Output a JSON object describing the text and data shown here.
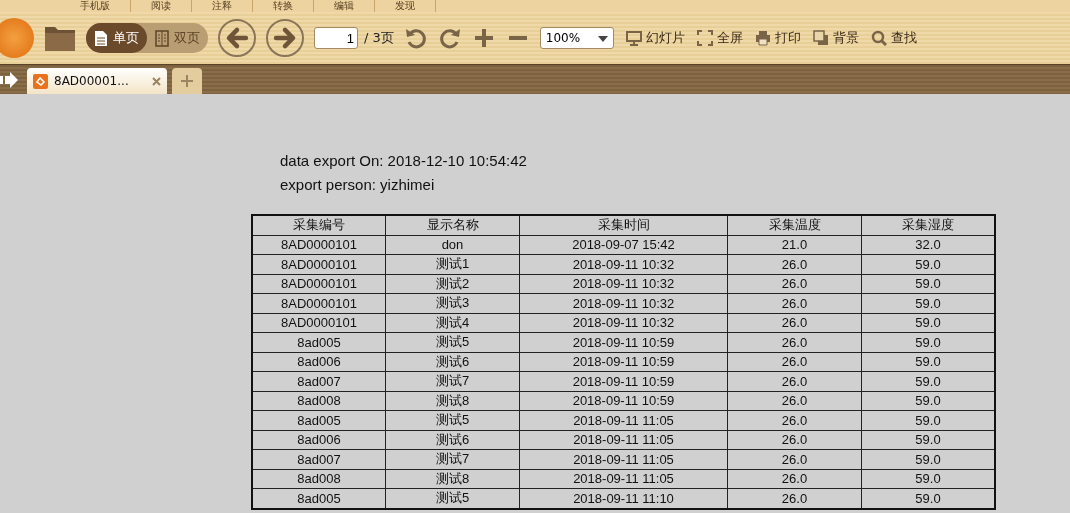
{
  "menu": [
    {
      "label": "手机版"
    },
    {
      "label": "阅读"
    },
    {
      "label": "注释"
    },
    {
      "label": "转换"
    },
    {
      "label": "编辑"
    },
    {
      "label": "发现"
    }
  ],
  "view_modes": [
    {
      "label": "单页",
      "selected": true
    },
    {
      "label": "双页",
      "selected": false
    }
  ],
  "page": {
    "value": "1",
    "total": "/ 3页"
  },
  "zoom": {
    "value": "100%"
  },
  "tools": [
    {
      "label": "幻灯片",
      "kind": "slides"
    },
    {
      "label": "全屏",
      "kind": "fullscreen"
    },
    {
      "label": "打印",
      "kind": "print"
    },
    {
      "label": "背景",
      "kind": "background"
    },
    {
      "label": "查找",
      "kind": "search"
    }
  ],
  "tabs": [
    {
      "label": "8AD00001...",
      "selected": true
    }
  ],
  "document": {
    "lines": [
      "data export On: 2018-12-10 10:54:42",
      "export person: yizhimei"
    ],
    "columns": [
      "采集编号",
      "显示名称",
      "采集时间",
      "采集温度",
      "采集湿度"
    ],
    "rows": [
      [
        "8AD0000101",
        "don",
        "2018-09-07 15:42",
        "21.0",
        "32.0"
      ],
      [
        "8AD0000101",
        "测试1",
        "2018-09-11 10:32",
        "26.0",
        "59.0"
      ],
      [
        "8AD0000101",
        "测试2",
        "2018-09-11 10:32",
        "26.0",
        "59.0"
      ],
      [
        "8AD0000101",
        "测试3",
        "2018-09-11 10:32",
        "26.0",
        "59.0"
      ],
      [
        "8AD0000101",
        "测试4",
        "2018-09-11 10:32",
        "26.0",
        "59.0"
      ],
      [
        "8ad005",
        "测试5",
        "2018-09-11 10:59",
        "26.0",
        "59.0"
      ],
      [
        "8ad006",
        "测试6",
        "2018-09-11 10:59",
        "26.0",
        "59.0"
      ],
      [
        "8ad007",
        "测试7",
        "2018-09-11 10:59",
        "26.0",
        "59.0"
      ],
      [
        "8ad008",
        "测试8",
        "2018-09-11 10:59",
        "26.0",
        "59.0"
      ],
      [
        "8ad005",
        "测试5",
        "2018-09-11 11:05",
        "26.0",
        "59.0"
      ],
      [
        "8ad006",
        "测试6",
        "2018-09-11 11:05",
        "26.0",
        "59.0"
      ],
      [
        "8ad007",
        "测试7",
        "2018-09-11 11:05",
        "26.0",
        "59.0"
      ],
      [
        "8ad008",
        "测试8",
        "2018-09-11 11:05",
        "26.0",
        "59.0"
      ],
      [
        "8ad005",
        "测试5",
        "2018-09-11 11:10",
        "26.0",
        "59.0"
      ]
    ]
  }
}
